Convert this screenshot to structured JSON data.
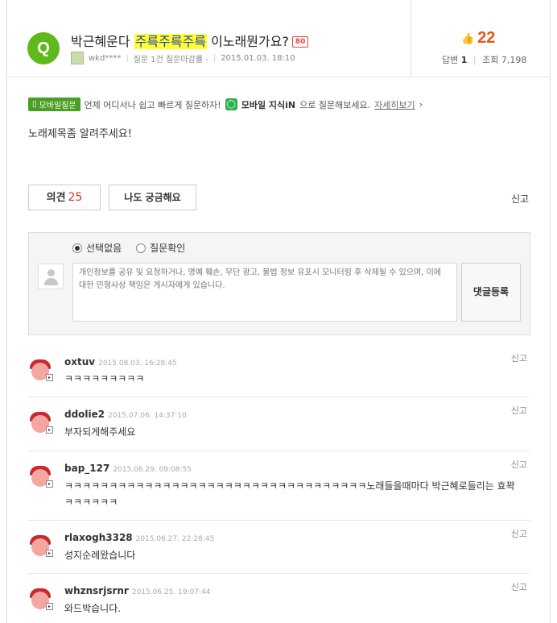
{
  "question": {
    "badge": "Q",
    "title_before": "박근혜운다 ",
    "title_highlight": "주륵주륵주륵",
    "title_after": " 이노래뭔가요?",
    "bounty": "80",
    "author": "wkd****",
    "status": "질문 1건 질문마감률 -",
    "date": "2015.01.03. 18:10",
    "likes": "22",
    "answers_label": "답변",
    "answers": "1",
    "views_label": "조회",
    "views": "7,198",
    "body": "노래제목좀 알려주세요!"
  },
  "mobile_promo": {
    "badge": "모바일질문",
    "text": "언제 어디서나 쉽고 빠르게 질문하자!",
    "kin_brand": "모바일 지식iN",
    "kin_suffix": "으로 질문해보세요.",
    "link": "자세히보기"
  },
  "actions": {
    "opinion_label": "의견",
    "opinion_count": "25",
    "curious_label": "나도 궁금해요",
    "report": "신고"
  },
  "compose": {
    "radio_none": "선택없음",
    "radio_check": "질문확인",
    "placeholder": "개인정보를 공유 및 요청하거나, 명예 훼손, 무단 광고, 불법 정보 유포시 모니터링 후 삭제될 수 있으며, 이에 대한 민형사상 책임은 게시자에게 있습니다.",
    "submit": "댓글등록"
  },
  "comments": [
    {
      "user": "oxtuv",
      "date": "2015.08.03. 16:28:45",
      "text": "ㅋㅋㅋㅋㅋㅋㅋㅋㅋ",
      "report": "신고"
    },
    {
      "user": "ddolie2",
      "date": "2015.07.06. 14:37:10",
      "text": "부자되게해주세요",
      "report": "신고"
    },
    {
      "user": "bap_127",
      "date": "2015.06.29. 09:08:55",
      "text": "ㅋㅋㅋㅋㅋㅋㅋㅋㅋㅋㅋㅋㅋㅋㅋㅋㅋㅋㅋㅋㅋㅋㅋㅋㅋㅋㅋㅋㅋㅋㅋㅋㅋㅋ노래들을때마다 박근혜로들리는 효꽉ㅋㅋㅋㅋㅋㅋ",
      "report": "신고"
    },
    {
      "user": "rlaxogh3328",
      "date": "2015.06.27. 22:28:45",
      "text": "성지순례왔습니다",
      "report": "신고"
    },
    {
      "user": "whznsrjsrnr",
      "date": "2015.06.25. 19:07:44",
      "text": "와드박습니다.",
      "report": "신고"
    }
  ]
}
